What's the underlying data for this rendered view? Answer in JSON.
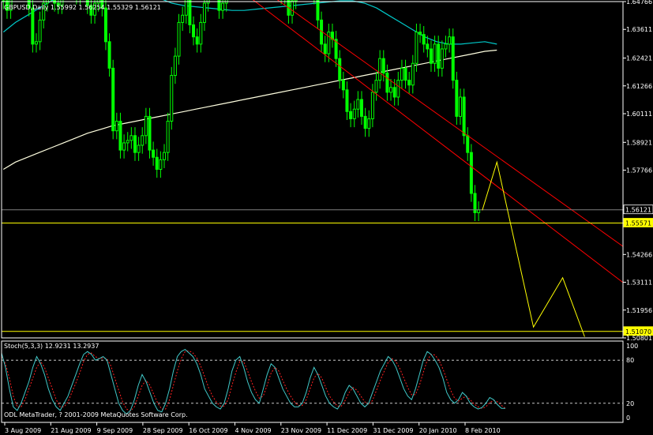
{
  "colors": {
    "background": "#000000",
    "frame": "#ffffff",
    "bull_candle": "#00ff00",
    "bear_candle": "#00ff00",
    "ma_white": "#ffffe0",
    "ma_cyan": "#00c8c8",
    "ma_tan": "#c8a040",
    "ma_blue": "#2020ff",
    "ma_red": "#ff2020",
    "trendline": "#ff0000",
    "level_line": "#ffff00",
    "forecast": "#ffff00",
    "stoch_main": "#40c8c8",
    "stoch_signal": "#ff2020",
    "stoch_levels": "#c8c8c8"
  },
  "chart_data": [
    {
      "type": "candlestick",
      "title": "GBPUSD,Daily  1.55992 1.56254 1.55329 1.56121",
      "symbol": "GBPUSD",
      "timeframe": "Daily",
      "ohlc_last": {
        "open": 1.55992,
        "high": 1.56254,
        "low": 1.55329,
        "close": 1.56121
      },
      "ylim": [
        1.50801,
        1.64766
      ],
      "y_ticks": [
        "1.64766",
        "1.63611",
        "1.62421",
        "1.61266",
        "1.60111",
        "1.58921",
        "1.57766",
        "1.56121",
        "1.55571",
        "1.54266",
        "1.53111",
        "1.51956",
        "1.51070",
        "1.50801"
      ],
      "x_ticks": [
        "3 Aug 2009",
        "21 Aug 2009",
        "9 Sep 2009",
        "28 Sep 2009",
        "16 Oct 2009",
        "4 Nov 2009",
        "23 Nov 2009",
        "11 Dec 2009",
        "31 Dec 2009",
        "20 Jan 2010",
        "8 Feb 2010"
      ],
      "price_labels": {
        "current": "1.56121",
        "level_high": "1.55571",
        "level_low": "1.51070"
      },
      "levels": [
        1.5557,
        1.5107
      ],
      "closes": [
        1.648,
        1.644,
        1.652,
        1.661,
        1.668,
        1.662,
        1.652,
        1.645,
        1.63,
        1.631,
        1.64,
        1.647,
        1.652,
        1.651,
        1.647,
        1.646,
        1.66,
        1.667,
        1.662,
        1.66,
        1.65,
        1.66,
        1.658,
        1.646,
        1.642,
        1.647,
        1.654,
        1.645,
        1.631,
        1.62,
        1.594,
        1.598,
        1.586,
        1.589,
        1.59,
        1.592,
        1.585,
        1.588,
        1.592,
        1.6,
        1.586,
        1.583,
        1.578,
        1.582,
        1.585,
        1.598,
        1.617,
        1.625,
        1.639,
        1.642,
        1.65,
        1.638,
        1.633,
        1.63,
        1.639,
        1.647,
        1.652,
        1.655,
        1.658,
        1.644,
        1.647,
        1.652,
        1.656,
        1.661,
        1.661,
        1.662,
        1.657,
        1.653,
        1.658,
        1.66,
        1.665,
        1.666,
        1.67,
        1.665,
        1.66,
        1.656,
        1.65,
        1.653,
        1.642,
        1.648,
        1.655,
        1.66,
        1.665,
        1.662,
        1.66,
        1.65,
        1.64,
        1.63,
        1.626,
        1.635,
        1.632,
        1.624,
        1.615,
        1.611,
        1.602,
        1.599,
        1.603,
        1.607,
        1.6,
        1.595,
        1.599,
        1.61,
        1.615,
        1.624,
        1.618,
        1.61,
        1.612,
        1.608,
        1.615,
        1.62,
        1.615,
        1.613,
        1.622,
        1.635,
        1.634,
        1.63,
        1.628,
        1.622,
        1.63,
        1.62,
        1.628,
        1.63,
        1.633,
        1.615,
        1.6,
        1.608,
        1.592,
        1.585,
        1.568,
        1.56,
        1.5612
      ],
      "ma_white": [
        1.578,
        1.581,
        1.583,
        1.585,
        1.587,
        1.589,
        1.591,
        1.593,
        1.5945,
        1.596,
        1.597,
        1.598,
        1.599,
        1.6,
        1.601,
        1.602,
        1.603,
        1.604,
        1.605,
        1.606,
        1.607,
        1.608,
        1.609,
        1.61,
        1.611,
        1.612,
        1.613,
        1.614,
        1.615,
        1.616,
        1.617,
        1.618,
        1.619,
        1.62,
        1.621,
        1.622,
        1.623,
        1.624,
        1.625,
        1.626,
        1.627,
        1.6275
      ],
      "ma_cyan": [
        1.635,
        1.639,
        1.642,
        1.645,
        1.648,
        1.65,
        1.652,
        1.653,
        1.654,
        1.6545,
        1.654,
        1.653,
        1.651,
        1.649,
        1.647,
        1.646,
        1.6455,
        1.645,
        1.6445,
        1.644,
        1.644,
        1.6445,
        1.645,
        1.6455,
        1.646,
        1.6465,
        1.647,
        1.6475,
        1.648,
        1.648,
        1.647,
        1.645,
        1.642,
        1.639,
        1.636,
        1.633,
        1.631,
        1.63,
        1.63,
        1.6305,
        1.631,
        1.63
      ],
      "stochastic": {
        "label": "Stoch(5,3,3) 12.9231 13.2937",
        "ylim": [
          0,
          100
        ],
        "levels": [
          20,
          80
        ],
        "y_ticks": [
          "100",
          "80",
          "20",
          "0"
        ],
        "main": [
          90,
          70,
          40,
          15,
          10,
          20,
          35,
          50,
          70,
          85,
          75,
          60,
          40,
          25,
          15,
          10,
          20,
          30,
          45,
          60,
          75,
          88,
          92,
          88,
          80,
          82,
          85,
          80,
          60,
          40,
          20,
          10,
          5,
          10,
          25,
          45,
          60,
          50,
          35,
          20,
          10,
          8,
          20,
          40,
          65,
          85,
          92,
          95,
          90,
          85,
          75,
          60,
          40,
          30,
          20,
          15,
          12,
          20,
          40,
          65,
          80,
          85,
          70,
          50,
          35,
          25,
          20,
          40,
          60,
          75,
          70,
          55,
          40,
          30,
          20,
          15,
          15,
          20,
          35,
          55,
          70,
          60,
          45,
          30,
          20,
          15,
          12,
          20,
          35,
          45,
          40,
          30,
          20,
          15,
          20,
          35,
          50,
          65,
          75,
          85,
          80,
          70,
          55,
          40,
          30,
          25,
          40,
          60,
          80,
          92,
          88,
          80,
          70,
          55,
          35,
          25,
          20,
          25,
          35,
          30,
          20,
          15,
          12,
          14,
          20,
          28,
          25,
          18,
          13,
          13
        ],
        "signal": [
          85,
          75,
          55,
          30,
          15,
          15,
          25,
          40,
          55,
          70,
          78,
          70,
          55,
          40,
          25,
          15,
          15,
          22,
          35,
          48,
          62,
          78,
          88,
          90,
          85,
          82,
          83,
          82,
          72,
          55,
          38,
          22,
          12,
          9,
          15,
          30,
          45,
          52,
          45,
          32,
          20,
          12,
          12,
          25,
          45,
          65,
          82,
          92,
          93,
          90,
          83,
          72,
          57,
          42,
          30,
          22,
          16,
          16,
          25,
          45,
          63,
          78,
          78,
          65,
          50,
          37,
          27,
          30,
          45,
          62,
          70,
          65,
          52,
          40,
          30,
          22,
          17,
          17,
          25,
          40,
          55,
          62,
          55,
          42,
          30,
          22,
          16,
          16,
          24,
          35,
          42,
          38,
          30,
          22,
          18,
          24,
          38,
          52,
          65,
          77,
          82,
          78,
          68,
          55,
          42,
          32,
          32,
          45,
          63,
          80,
          88,
          87,
          80,
          68,
          53,
          38,
          27,
          23,
          27,
          30,
          25,
          19,
          15,
          13,
          15,
          21,
          24,
          22,
          17,
          13
        ]
      },
      "forecast_path": [
        {
          "label": "p0",
          "bar": 131,
          "price": 1.561
        },
        {
          "label": "p1",
          "bar": 135,
          "price": 1.581
        },
        {
          "label": "p2",
          "bar": 145,
          "price": 1.5125
        },
        {
          "label": "p3",
          "bar": 153,
          "price": 1.533
        },
        {
          "label": "p4",
          "bar": 159,
          "price": 1.5085
        }
      ],
      "trendlines": [
        {
          "from": {
            "bar": 55,
            "price": 1.67
          },
          "to": {
            "bar": 170,
            "price": 1.546
          }
        },
        {
          "from": {
            "bar": 60,
            "price": 1.658
          },
          "to": {
            "bar": 170,
            "price": 1.531
          }
        }
      ]
    }
  ],
  "footer": {
    "copyright": "ODL MetaTrader, ? 2001-2009 MetaQuotes Software Corp."
  }
}
